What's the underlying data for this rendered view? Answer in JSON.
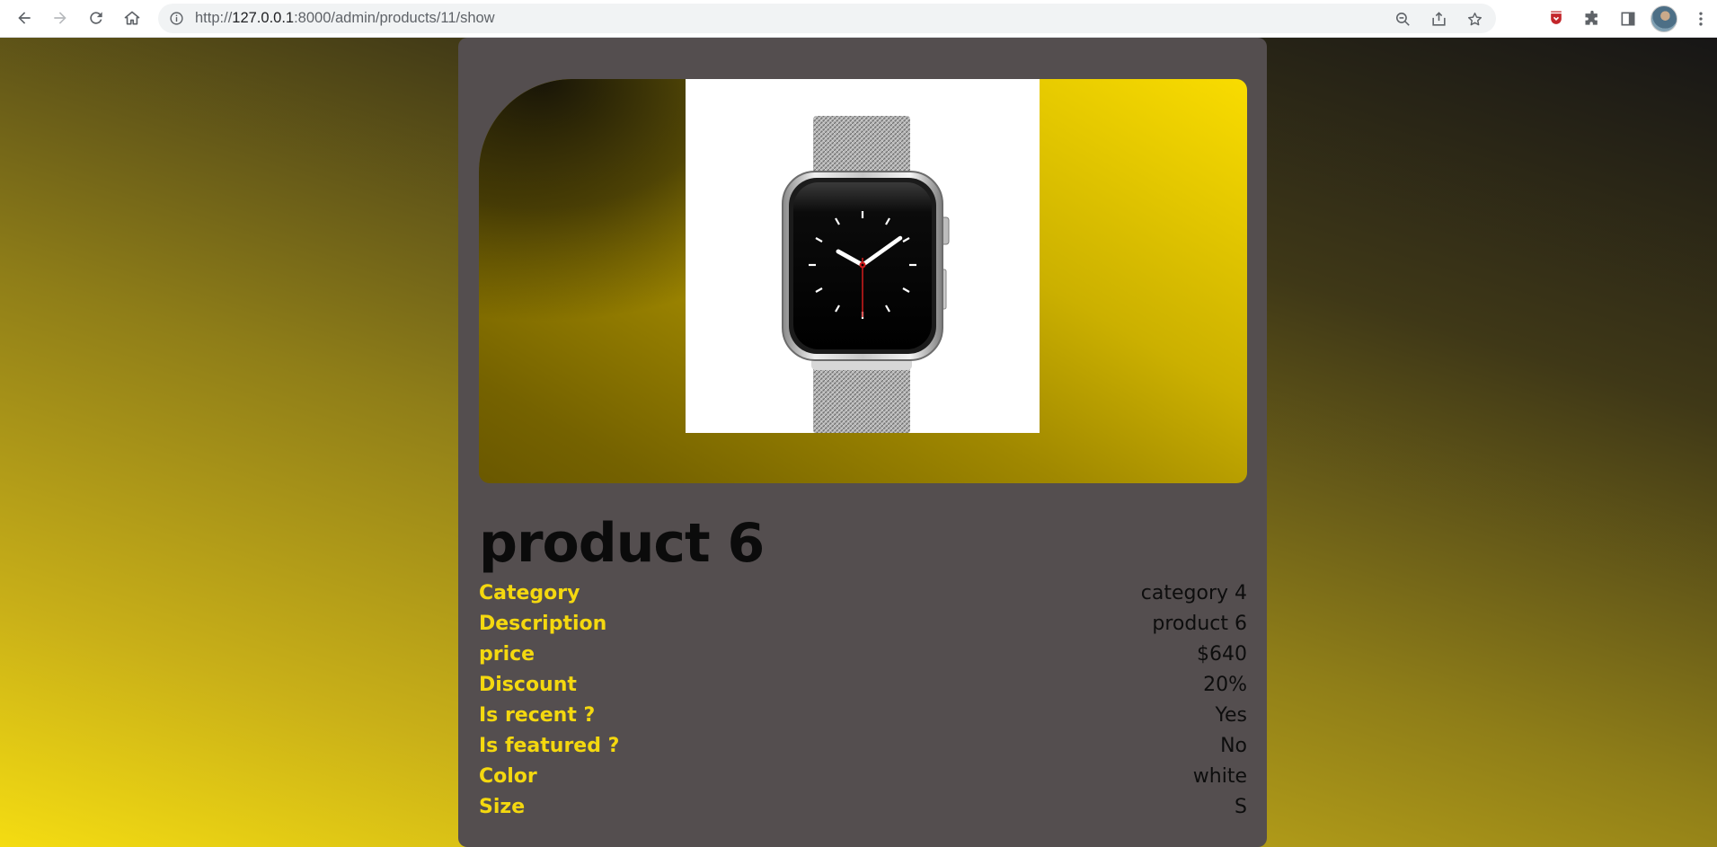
{
  "browser": {
    "url_prefix": "http://",
    "url_host": "127.0.0.1",
    "url_rest": ":8000/admin/products/11/show",
    "icons": {
      "back": "back-arrow-icon",
      "forward": "forward-arrow-icon",
      "reload": "reload-icon",
      "home": "home-icon",
      "site_info": "info-icon",
      "zoom": "zoom-out-icon",
      "share": "share-icon",
      "bookmark": "star-icon",
      "extension_pdf": "shield-extension-icon",
      "extensions": "puzzle-icon",
      "side_panel": "side-panel-icon",
      "profile": "avatar",
      "menu": "kebab-menu-icon"
    }
  },
  "product": {
    "image_alt": "apple watch product image",
    "title": "product 6",
    "details": [
      {
        "label": "Category",
        "value": "category 4"
      },
      {
        "label": "Description",
        "value": "product 6"
      },
      {
        "label": "price",
        "value": "$640"
      },
      {
        "label": "Discount",
        "value": "20%"
      },
      {
        "label": "Is recent ?",
        "value": "Yes"
      },
      {
        "label": "Is featured ?",
        "value": "No"
      },
      {
        "label": "Color",
        "value": "white"
      },
      {
        "label": "Size",
        "value": "S"
      }
    ]
  },
  "colors": {
    "label": "#f4d80f",
    "card_background": "#544e4f",
    "accent": "#f9dc00"
  }
}
